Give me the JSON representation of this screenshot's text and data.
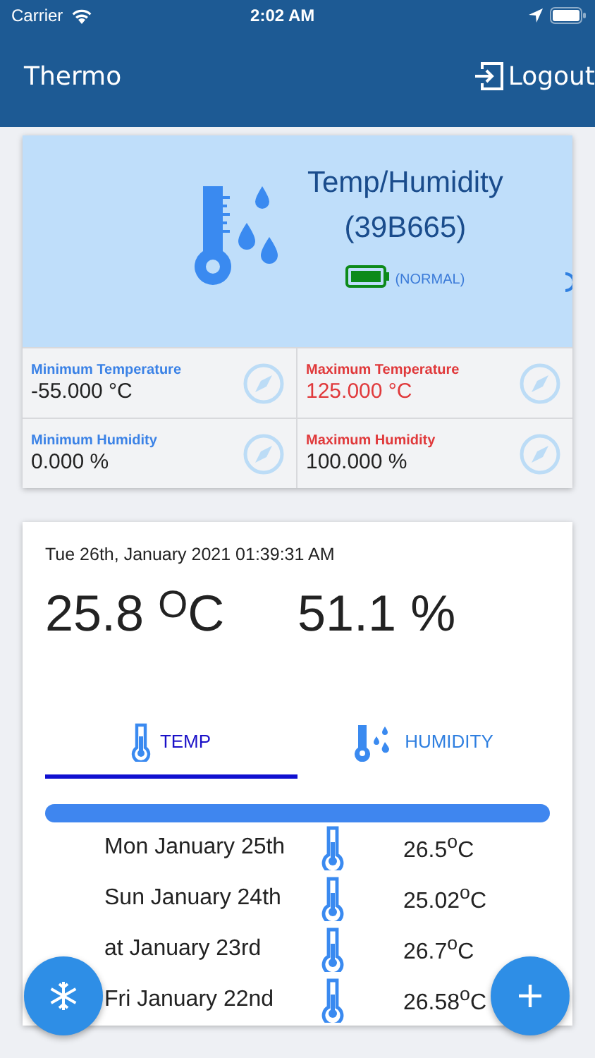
{
  "status_bar": {
    "carrier": "Carrier",
    "time": "2:02 AM"
  },
  "header": {
    "title": "Thermo",
    "logout": "Logout"
  },
  "device": {
    "name": "Temp/Humidity",
    "id": "(39B665)",
    "battery_status": "(NORMAL)",
    "stats": [
      {
        "kind": "min",
        "label": "Minimum Temperature",
        "value": "-55.000 °C",
        "alert": false
      },
      {
        "kind": "max",
        "label": "Maximum Temperature",
        "value": "125.000 °C",
        "alert": true
      },
      {
        "kind": "min",
        "label": "Minimum Humidity",
        "value": "0.000 %",
        "alert": false
      },
      {
        "kind": "max",
        "label": "Maximum Humidity",
        "value": "100.000 %",
        "alert": false
      }
    ]
  },
  "reading": {
    "timestamp": "Tue 26th, January 2021 01:39:31 AM",
    "temperature": "25.8 $^{O}$C",
    "humidity": "51.1 %"
  },
  "tabs": [
    {
      "kind": "temp",
      "label": "TEMP",
      "selected": true
    },
    {
      "kind": "humidity",
      "label": "HUMIDITY",
      "selected": false
    }
  ],
  "history": [
    {
      "date": "Mon January 25th",
      "value": "26.5$^{o}$C"
    },
    {
      "date": "Sun January 24th",
      "value": "25.02$^{o}$C"
    },
    {
      "date": "at January 23rd",
      "value": "26.7$^{o}$C"
    },
    {
      "date": "Fri January 22nd",
      "value": "26.58$^{o}$C"
    }
  ]
}
